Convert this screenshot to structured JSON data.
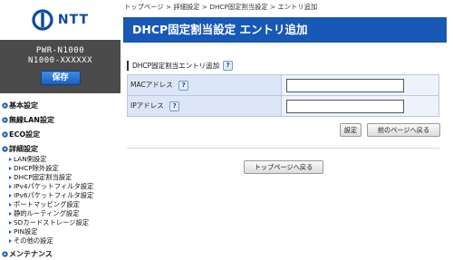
{
  "brand": {
    "logo_text": "NTT",
    "logo_color": "#0b4aa0"
  },
  "device": {
    "model": "PWR-N1000",
    "serial": "N1000-XXXXXX",
    "save_label": "保存"
  },
  "nav": {
    "main": [
      {
        "label": "基本設定"
      },
      {
        "label": "無線LAN設定"
      },
      {
        "label": "ECO設定"
      },
      {
        "label": "詳細設定"
      }
    ],
    "sub": [
      {
        "label": "LAN側設定"
      },
      {
        "label": "DHCP除外設定"
      },
      {
        "label": "DHCP固定割当設定"
      },
      {
        "label": "IPv4パケットフィルタ設定"
      },
      {
        "label": "IPv6パケットフィルタ設定"
      },
      {
        "label": "ポートマッピング設定"
      },
      {
        "label": "静的ルーティング設定"
      },
      {
        "label": "SDカードストレージ設定"
      },
      {
        "label": "PIN設定"
      },
      {
        "label": "その他の設定"
      }
    ],
    "maintenance": {
      "label": "メンテナンス"
    }
  },
  "breadcrumb": "トップページ > 詳細設定 > DHCP固定割当設定 > エントリ追加",
  "page_title": "DHCP固定割当設定 エントリ追加",
  "section": {
    "title": "DHCP固定割当エントリ追加",
    "help": "?"
  },
  "form": {
    "rows": [
      {
        "label": "MACアドレス",
        "help": "?",
        "value": ""
      },
      {
        "label": "IPアドレス",
        "help": "?",
        "value": ""
      }
    ]
  },
  "buttons": {
    "set": "設定",
    "back": "前のページへ戻る",
    "top": "トップページへ戻る"
  },
  "colors": {
    "title_bar": "#1858b6",
    "device_box": "#4b4b4b",
    "label_cell": "#dce6f6"
  }
}
